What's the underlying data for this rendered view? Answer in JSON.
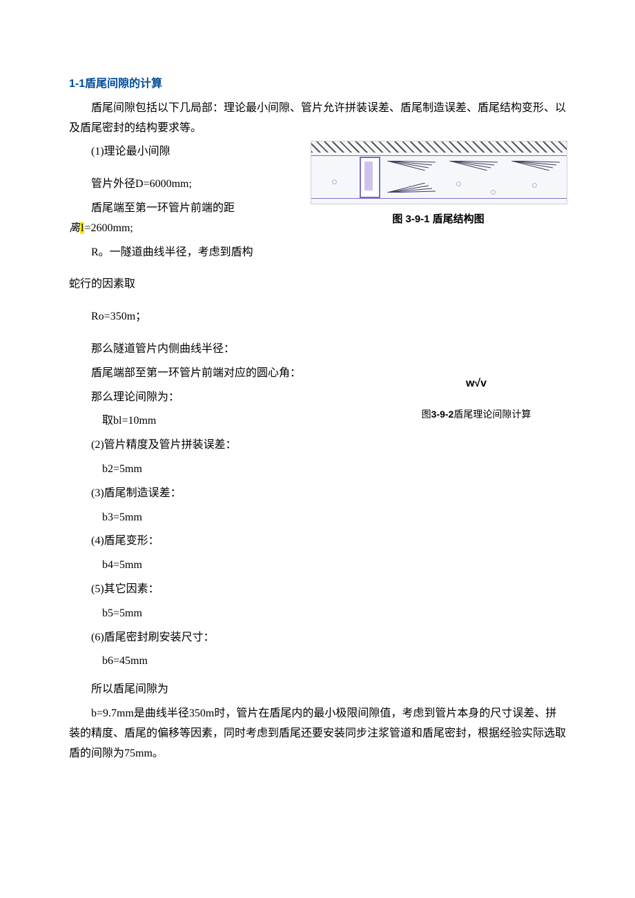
{
  "heading": "1-1盾尾间隙的计算",
  "intro": "盾尾间隙包括以下几局部：理论最小间隙、管片允许拼装误差、盾尾制造误差、盾尾结构变形、以及盾尾密封的结构要求等。",
  "item1_title": "(1)理论最小间隙",
  "fig1_caption": "图 3-9-1 盾尾结构图",
  "d_line": "管片外径D=6000mm;",
  "l_line_prefix": "盾尾端至第一环管片前端的距",
  "l_line_italic": "离",
  "l_line_hl": "l",
  "l_line_suffix": "=2600mm;",
  "r_line": "R。一隧道曲线半径，考虑到盾构",
  "snake": "蛇行的因素取",
  "ro_line": "Ro=350m；",
  "inner_radius": "那么隧道管片内侧曲线半径：",
  "angle": "盾尾端部至第一环管片前端对应的圆心角：",
  "theory_gap": "那么理论间隙为：",
  "bl": "取bl=10mm",
  "fig2_symbol": "w√v",
  "fig2_caption_prefix": "图",
  "fig2_caption_mid": "3-9-2",
  "fig2_caption_suffix": "盾尾理论间隙计算",
  "item2_title": "(2)管片精度及管片拼装误差：",
  "b2": "b2=5mm",
  "item3_title": "(3)盾尾制造误差：",
  "b3": "b3=5mm",
  "item4_title": "(4)盾尾变形：",
  "b4": "b4=5mm",
  "item5_title": "(5)其它因素：",
  "b5": "b5=5mm",
  "item6_title": "(6)盾尾密封刷安装尺寸：",
  "b6": "b6=45mm",
  "so_gap": "所以盾尾间隙为",
  "final": "b=9.7mm是曲线半径350m时，管片在盾尾内的最小极限间隙值，考虑到管片本身的尺寸误差、拼装的精度、盾尾的偏移等因素，同时考虑到盾尾还要安装同步注浆管道和盾尾密封，根据经验实际选取盾的间隙为75mm。"
}
